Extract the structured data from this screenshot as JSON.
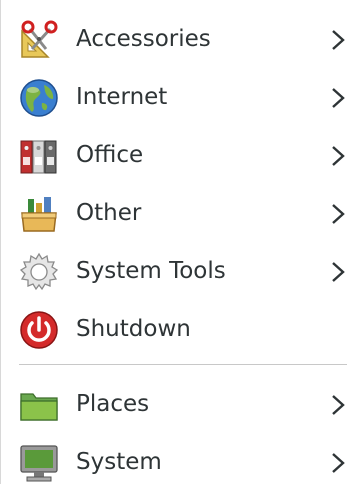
{
  "menu": {
    "items": [
      {
        "label": "Accessories",
        "icon": "accessories-icon",
        "submenu": true
      },
      {
        "label": "Internet",
        "icon": "globe-icon",
        "submenu": true
      },
      {
        "label": "Office",
        "icon": "office-binders-icon",
        "submenu": true
      },
      {
        "label": "Other",
        "icon": "other-box-icon",
        "submenu": true
      },
      {
        "label": "System Tools",
        "icon": "gear-icon",
        "submenu": true
      },
      {
        "label": "Shutdown",
        "icon": "power-icon",
        "submenu": false
      }
    ],
    "places": [
      {
        "label": "Places",
        "icon": "folder-icon",
        "submenu": true
      },
      {
        "label": "System",
        "icon": "computer-monitor-icon",
        "submenu": true
      }
    ]
  }
}
